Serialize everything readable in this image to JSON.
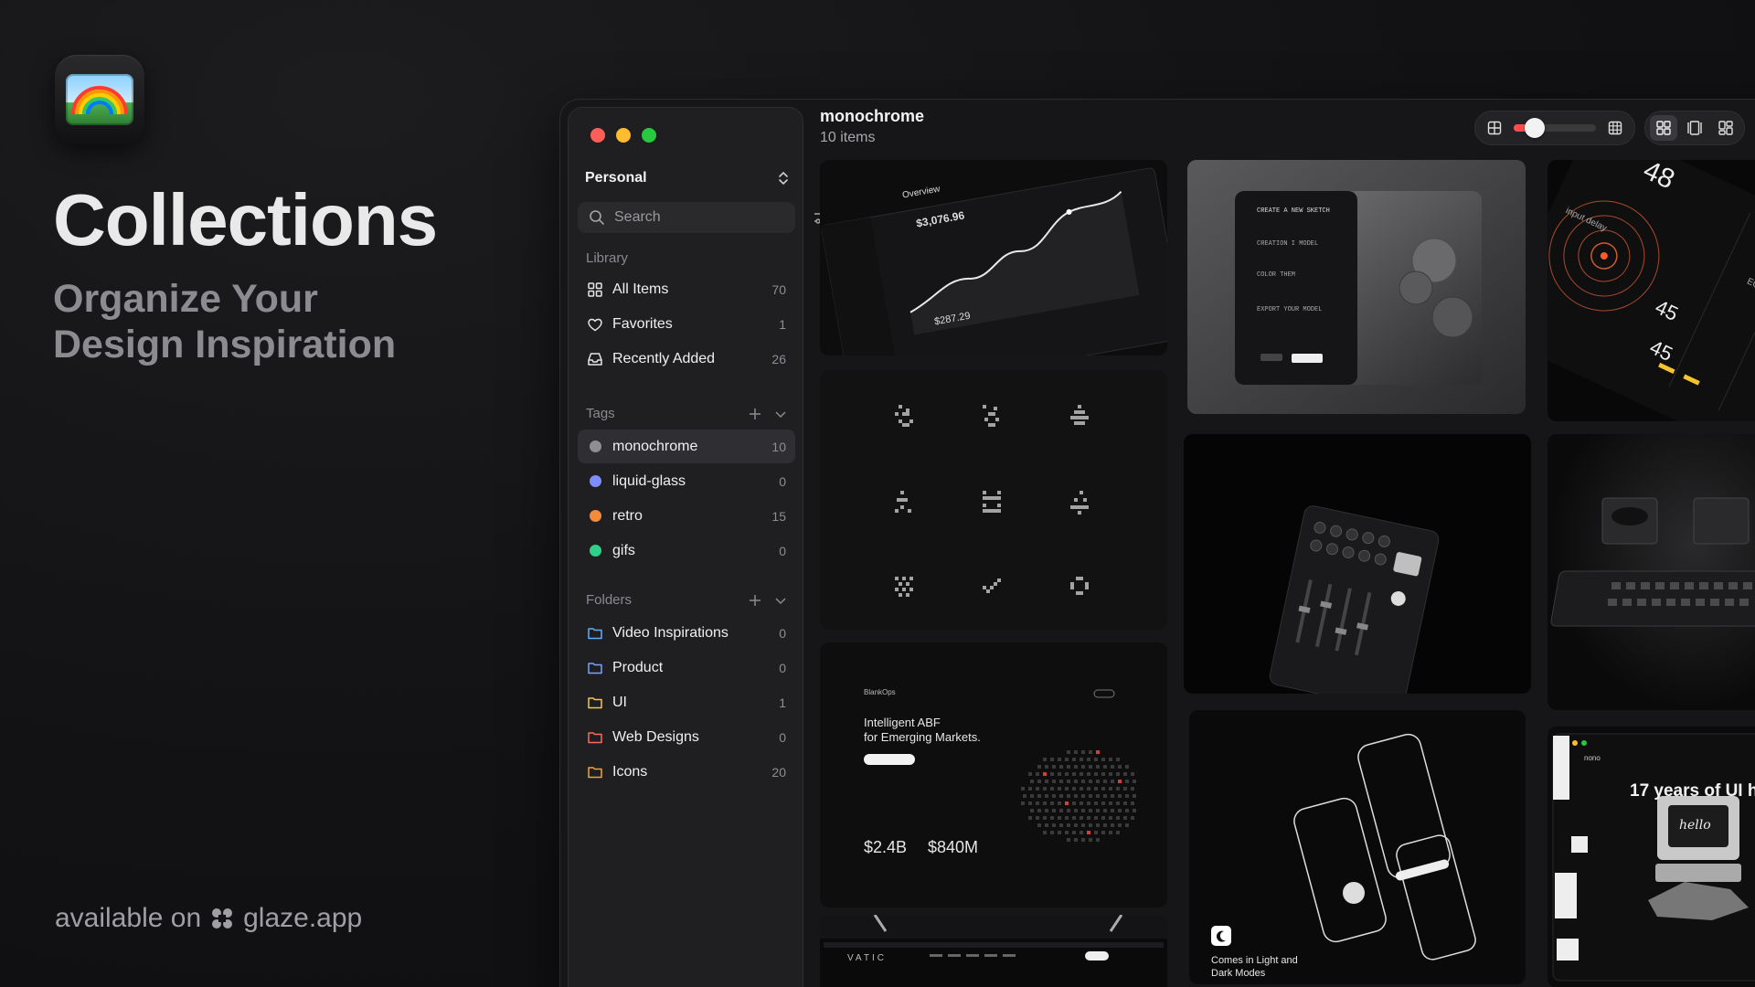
{
  "hero": {
    "title": "Collections",
    "subtitle_line1": "Organize Your",
    "subtitle_line2": "Design Inspiration",
    "available_prefix": "available on",
    "available_site": "glaze.app"
  },
  "sidebar": {
    "workspace": "Personal",
    "search_placeholder": "Search",
    "library_header": "Library",
    "library": [
      {
        "label": "All Items",
        "count": "70",
        "icon": "grid-icon"
      },
      {
        "label": "Favorites",
        "count": "1",
        "icon": "heart-icon"
      },
      {
        "label": "Recently Added",
        "count": "26",
        "icon": "inbox-icon"
      }
    ],
    "tags_header": "Tags",
    "tags": [
      {
        "label": "monochrome",
        "count": "10",
        "color": "#8e8e93"
      },
      {
        "label": "liquid-glass",
        "count": "0",
        "color": "#7d8cff"
      },
      {
        "label": "retro",
        "count": "15",
        "color": "#f48b3c"
      },
      {
        "label": "gifs",
        "count": "0",
        "color": "#30d08a"
      }
    ],
    "folders_header": "Folders",
    "folders": [
      {
        "label": "Video Inspirations",
        "count": "0",
        "color": "#5ab0ff"
      },
      {
        "label": "Product",
        "count": "0",
        "color": "#7aa2ff"
      },
      {
        "label": "UI",
        "count": "1",
        "color": "#f5c451"
      },
      {
        "label": "Web Designs",
        "count": "0",
        "color": "#ff6a5c"
      },
      {
        "label": "Icons",
        "count": "20",
        "color": "#f2a23a"
      }
    ]
  },
  "main": {
    "title": "monochrome",
    "item_count": "10 items",
    "zoom_level": 0.25
  },
  "tiles": {
    "dashboard": {
      "title": "Overview",
      "value1": "$3,076.96",
      "value2": "$287.29"
    },
    "sketch": {
      "line1": "CREATE A NEW SKETCH",
      "line2": "CREATION I MODEL",
      "line3": "COLOR THEM",
      "line4": "EXPORT YOUR MODEL"
    },
    "gauge": {
      "top": "48",
      "v1": "45",
      "v2": "45",
      "lbl1": "input delay",
      "lbl2": "EQ"
    },
    "web": {
      "brand": "BlankOps",
      "headline1": "Intelligent ABF",
      "headline2": "for Emerging Markets.",
      "stat1": "$2.4B",
      "stat2": "$840M"
    },
    "phones": {
      "caption1": "Comes in Light and",
      "caption2": "Dark Modes"
    },
    "nono": {
      "brand": "nono",
      "headline": "17 years of UI h",
      "hello": "hello"
    },
    "vatic": {
      "brand": "VATIC"
    }
  }
}
